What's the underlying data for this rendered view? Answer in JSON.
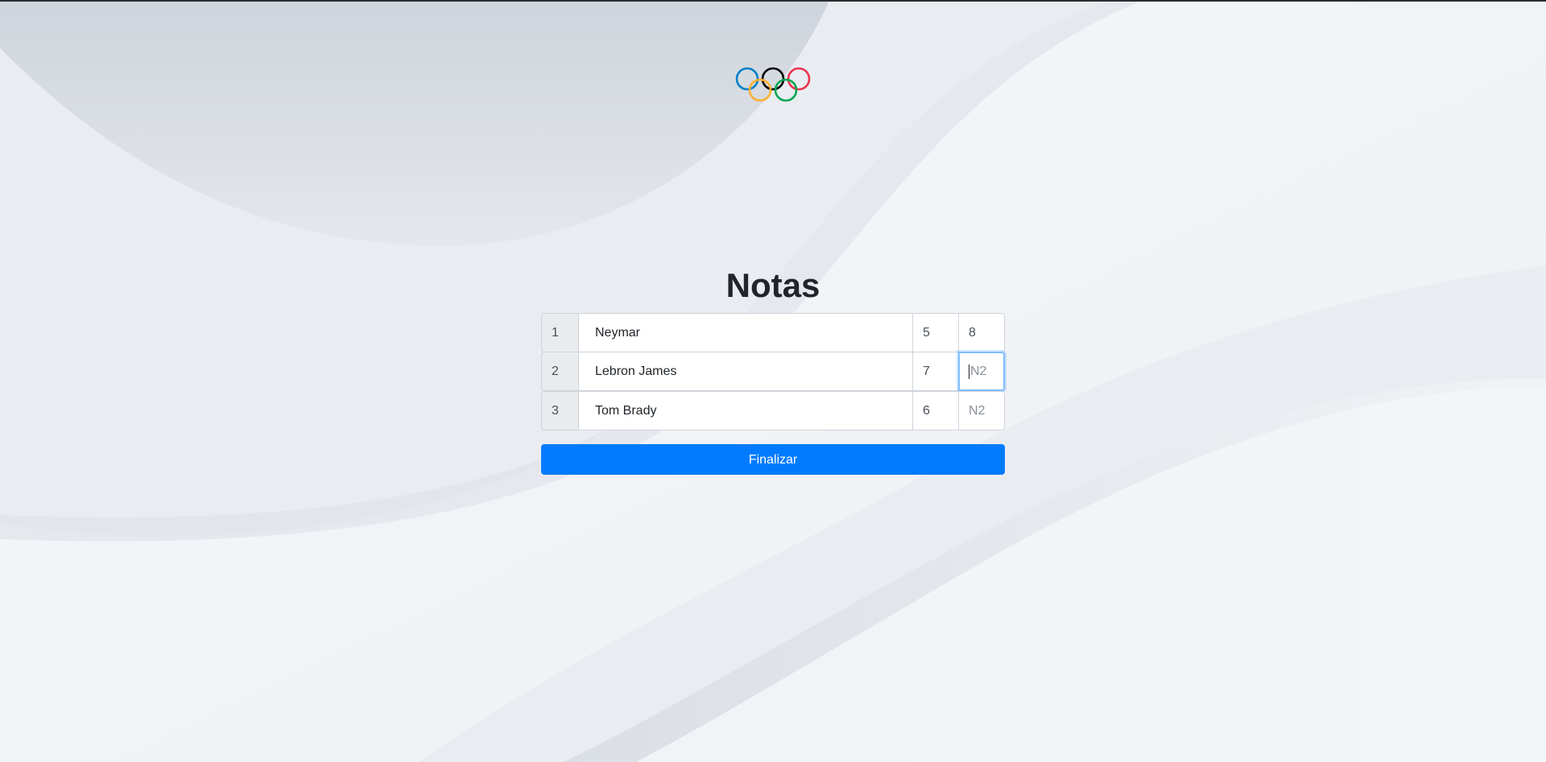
{
  "page": {
    "title": "Notas",
    "logo_icon": "olympic-rings-icon"
  },
  "colors": {
    "primary_button": "#007bff",
    "title_text": "#212529",
    "ring_blue": "#0081c8",
    "ring_yellow": "#fcb131",
    "ring_black": "#000000",
    "ring_green": "#00a651",
    "ring_red": "#ee334e"
  },
  "grades": {
    "rows": [
      {
        "index": "1",
        "name": "Neymar",
        "n1": "5",
        "n2": "8",
        "n2_placeholder": "N2"
      },
      {
        "index": "2",
        "name": "Lebron James",
        "n1": "7",
        "n2": "",
        "n2_placeholder": "N2"
      },
      {
        "index": "3",
        "name": "Tom Brady",
        "n1": "6",
        "n2": "",
        "n2_placeholder": "N2"
      }
    ]
  },
  "actions": {
    "finalize_label": "Finalizar"
  }
}
